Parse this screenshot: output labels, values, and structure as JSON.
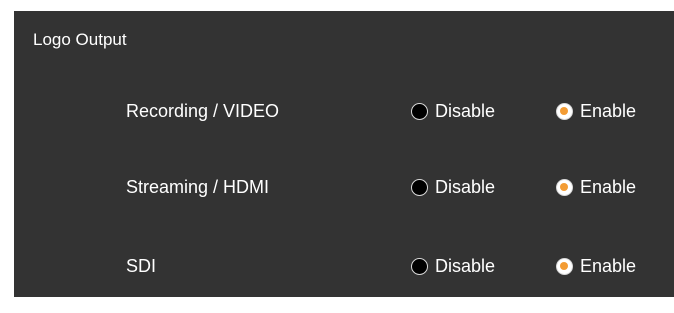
{
  "section": {
    "title": "Logo Output"
  },
  "colors": {
    "panel_background": "#333333",
    "selected_dot": "#f39c34",
    "text": "#ffffff"
  },
  "rows": [
    {
      "label": "Recording / VIDEO",
      "options": [
        {
          "label": "Disable",
          "selected": false
        },
        {
          "label": "Enable",
          "selected": true
        }
      ]
    },
    {
      "label": "Streaming / HDMI",
      "options": [
        {
          "label": "Disable",
          "selected": false
        },
        {
          "label": "Enable",
          "selected": true
        }
      ]
    },
    {
      "label": "SDI",
      "options": [
        {
          "label": "Disable",
          "selected": false
        },
        {
          "label": "Enable",
          "selected": true
        }
      ]
    }
  ]
}
